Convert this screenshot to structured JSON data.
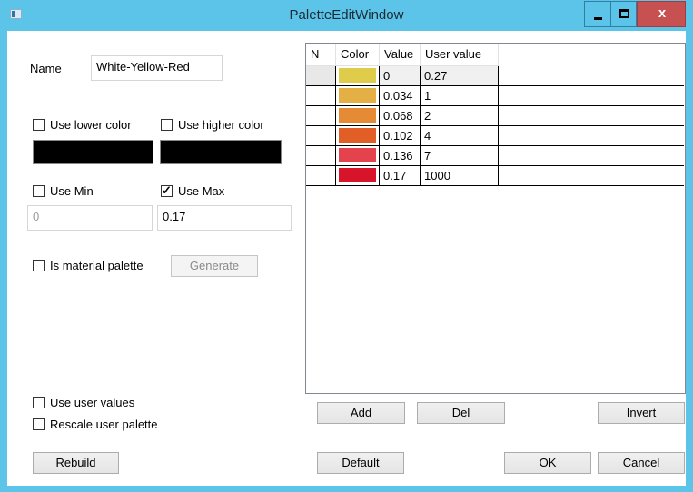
{
  "window": {
    "title": "PaletteEditWindow",
    "close_glyph": "x"
  },
  "form": {
    "name_label": "Name",
    "name_value": "White-Yellow-Red",
    "use_lower_color": {
      "label": "Use lower color",
      "checked": false
    },
    "use_higher_color": {
      "label": "Use higher color",
      "checked": false
    },
    "lower_color": "#000000",
    "higher_color": "#000000",
    "use_min": {
      "label": "Use Min",
      "checked": false
    },
    "use_max": {
      "label": "Use Max",
      "checked": true
    },
    "min_value": "0",
    "max_value": "0.17",
    "is_material_palette": {
      "label": "Is material palette",
      "checked": false
    },
    "generate_label": "Generate",
    "use_user_values": {
      "label": "Use user values",
      "checked": false
    },
    "rescale_user_palette": {
      "label": "Rescale user palette",
      "checked": false
    },
    "rebuild_label": "Rebuild"
  },
  "grid": {
    "columns": [
      "N",
      "Color",
      "Value",
      "User value"
    ],
    "rows": [
      {
        "n": "",
        "color": "#dfcc4a",
        "value": "0",
        "user_value": "0.27"
      },
      {
        "n": "",
        "color": "#e4af45",
        "value": "0.034",
        "user_value": "1"
      },
      {
        "n": "",
        "color": "#e58a35",
        "value": "0.068",
        "user_value": "2"
      },
      {
        "n": "",
        "color": "#e15f27",
        "value": "0.102",
        "user_value": "4"
      },
      {
        "n": "",
        "color": "#e4434d",
        "value": "0.136",
        "user_value": "7"
      },
      {
        "n": "",
        "color": "#d8142b",
        "value": "0.17",
        "user_value": "1000"
      }
    ]
  },
  "buttons": {
    "add": "Add",
    "del": "Del",
    "invert": "Invert",
    "default": "Default",
    "ok": "OK",
    "cancel": "Cancel"
  }
}
